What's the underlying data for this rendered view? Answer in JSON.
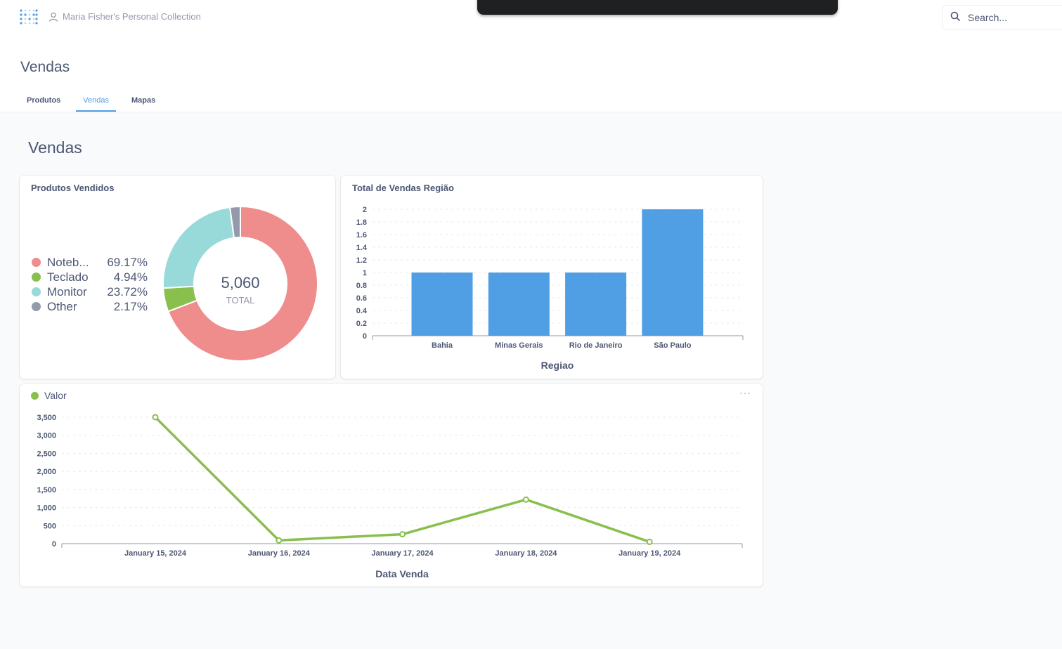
{
  "header": {
    "collection": "Maria Fisher's Personal Collection",
    "search_placeholder": "Search..."
  },
  "page": {
    "title": "Vendas",
    "tabs": [
      {
        "label": "Produtos",
        "active": false
      },
      {
        "label": "Vendas",
        "active": true
      },
      {
        "label": "Mapas",
        "active": false
      }
    ]
  },
  "dashboard": {
    "title": "Vendas"
  },
  "cards": {
    "pie": {
      "title": "Produtos Vendidos",
      "center_value": "5,060",
      "center_label": "TOTAL",
      "legend": [
        {
          "name": "Noteb...",
          "pct": "69.17%",
          "color": "#ef8c8c"
        },
        {
          "name": "Teclado",
          "pct": "4.94%",
          "color": "#88bf4d"
        },
        {
          "name": "Monitor",
          "pct": "23.72%",
          "color": "#98d9d9"
        },
        {
          "name": "Other",
          "pct": "2.17%",
          "color": "#949aab"
        }
      ]
    },
    "bar": {
      "title": "Total de Vendas Região"
    },
    "line": {
      "legend": "Valor",
      "more": "···"
    }
  },
  "chart_data": [
    {
      "type": "pie",
      "title": "Produtos Vendidos",
      "categories": [
        "Noteb...",
        "Teclado",
        "Monitor",
        "Other"
      ],
      "values": [
        69.17,
        4.94,
        23.72,
        2.17
      ],
      "total": "5,060",
      "colors": [
        "#ef8c8c",
        "#88bf4d",
        "#98d9d9",
        "#949aab"
      ],
      "legend": "left"
    },
    {
      "type": "bar",
      "title": "Total de Vendas Região",
      "categories": [
        "Bahia",
        "Minas Gerais",
        "Rio de Janeiro",
        "São Paulo"
      ],
      "values": [
        1,
        1,
        1,
        2
      ],
      "xlabel": "Regiao",
      "ylabel": "",
      "ylim": [
        0,
        2
      ],
      "yticks": [
        "0",
        "0.2",
        "0.4",
        "0.6",
        "0.8",
        "1",
        "1.2",
        "1.4",
        "1.6",
        "1.8",
        "2"
      ],
      "color": "#509ee3",
      "grid": true
    },
    {
      "type": "line",
      "x": [
        "January 15, 2024",
        "January 16, 2024",
        "January 17, 2024",
        "January 18, 2024",
        "January 19, 2024"
      ],
      "series": [
        {
          "name": "Valor",
          "values": [
            3500,
            90,
            260,
            1220,
            50
          ],
          "color": "#88bf4d"
        }
      ],
      "xlabel": "Data Venda",
      "ylabel": "",
      "ylim": [
        0,
        3500
      ],
      "yticks": [
        "0",
        "500",
        "1,000",
        "1,500",
        "2,000",
        "2,500",
        "3,000",
        "3,500"
      ],
      "grid": true,
      "legend": "top-left"
    }
  ]
}
